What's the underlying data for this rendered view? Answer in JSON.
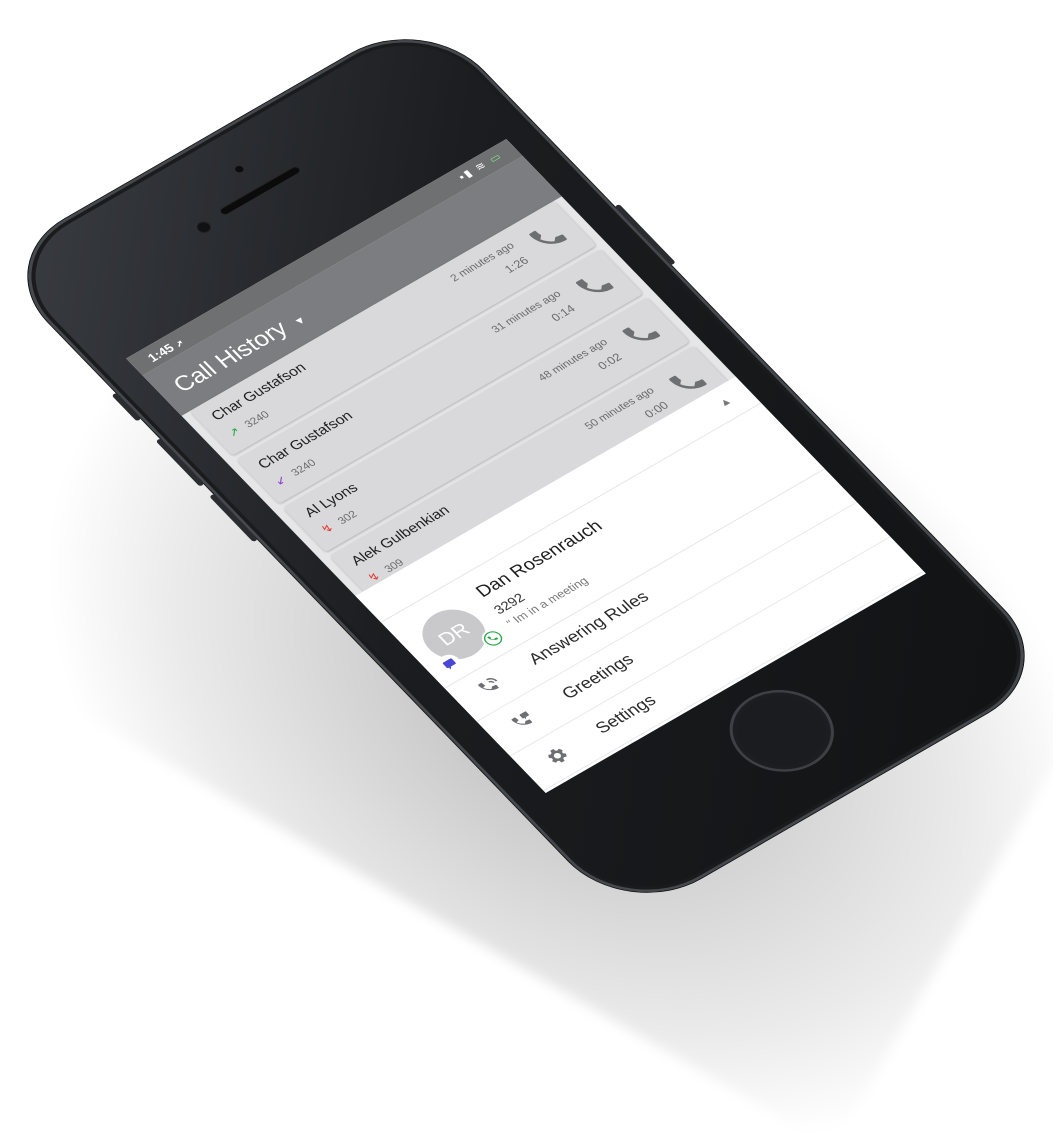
{
  "status_bar": {
    "time": "1:45",
    "location_glyph": "➚",
    "signal_glyph": "▪▮",
    "wifi_glyph": "≋",
    "battery_glyph": "▭"
  },
  "header": {
    "title": "Call History",
    "dropdown_glyph": "▾"
  },
  "calls": [
    {
      "name": "Char Gustafson",
      "ext": "3240",
      "direction": "outgoing",
      "direction_glyph": "↗",
      "direction_color": "#2aa84a",
      "ago": "2 minutes ago",
      "duration": "1:26"
    },
    {
      "name": "Char Gustafson",
      "ext": "3240",
      "direction": "incoming",
      "direction_glyph": "↙",
      "direction_color": "#8a3fd1",
      "ago": "31 minutes ago",
      "duration": "0:14"
    },
    {
      "name": "Al Lyons",
      "ext": "302",
      "direction": "missed",
      "direction_glyph": "↯",
      "direction_color": "#e53935",
      "ago": "48 minutes ago",
      "duration": "0:02"
    },
    {
      "name": "Alek Gulbenkian",
      "ext": "309",
      "direction": "missed",
      "direction_glyph": "↯",
      "direction_color": "#e53935",
      "ago": "50 minutes ago",
      "duration": "0:00"
    }
  ],
  "drawer": {
    "chevron_glyph": "▲",
    "profile": {
      "initials": "DR",
      "name": "Dan Rosenrauch",
      "ext": "3292",
      "status": "“ Im in a meeting"
    },
    "menu": [
      {
        "label": "Answering Rules",
        "icon": "answering-rules-icon"
      },
      {
        "label": "Greetings",
        "icon": "greetings-icon"
      },
      {
        "label": "Settings",
        "icon": "gear-icon"
      }
    ]
  },
  "colors": {
    "call_icon": "#6e6f72",
    "header_bg": "#7c7d80",
    "status_bg": "#6f7072",
    "chat_badge": "#4a46d6",
    "phone_badge": "#2aa84a"
  }
}
